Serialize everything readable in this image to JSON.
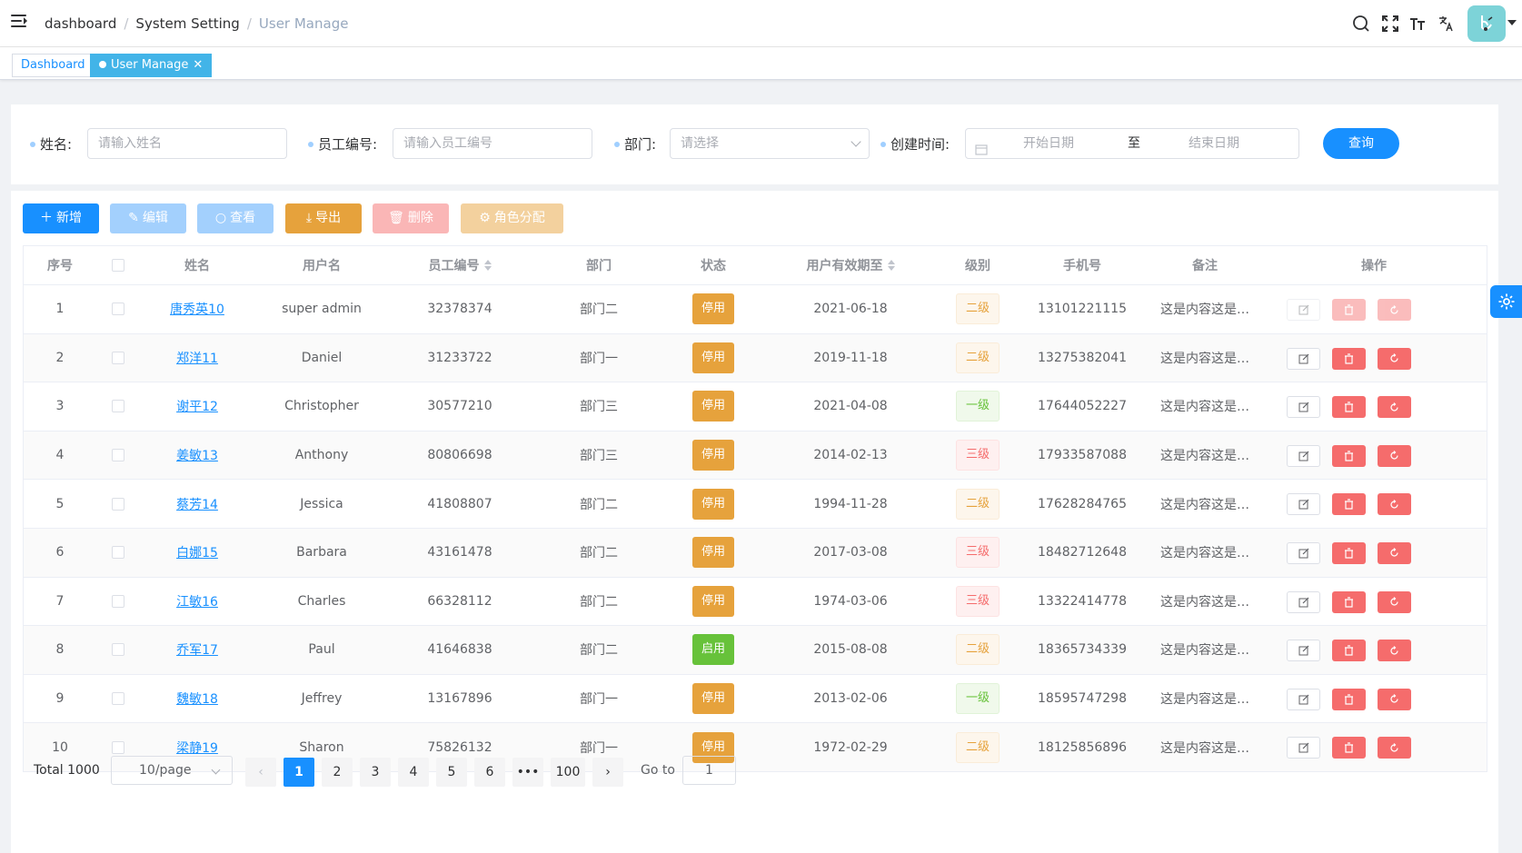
{
  "navbar": {
    "breadcrumbs": [
      "dashboard",
      "System Setting",
      "User Manage"
    ],
    "icons": [
      "search-icon",
      "fullscreen-icon",
      "font-size-icon",
      "translate-icon"
    ]
  },
  "tags": {
    "items": [
      {
        "label": "Dashboard",
        "active": false
      },
      {
        "label": "User Manage",
        "active": true,
        "close": "✕"
      }
    ]
  },
  "search": {
    "name_label": "姓名:",
    "name_placeholder": "请输入姓名",
    "empno_label": "员工编号:",
    "empno_placeholder": "请输入员工编号",
    "dept_label": "部门:",
    "dept_placeholder": "请选择",
    "created_label": "创建时间:",
    "start_placeholder": "开始日期",
    "range_sep": "至",
    "end_placeholder": "结束日期",
    "query_button": "查询"
  },
  "toolbar": {
    "add": "新增",
    "edit": "编辑",
    "view": "查看",
    "export": "导出",
    "delete": "删除",
    "role": "角色分配",
    "colors": {
      "add": "#1890ff",
      "edit": "#a3d0fd",
      "view": "#a3d0fd",
      "export": "#e6a23c",
      "delete": "#fab6b6",
      "role": "#f3d19e"
    }
  },
  "table": {
    "headers": [
      "序号",
      "",
      "姓名",
      "用户名",
      "员工编号",
      "部门",
      "状态",
      "用户有效期至",
      "级别",
      "手机号",
      "备注",
      "操作"
    ],
    "rows": [
      {
        "idx": "1",
        "name": "唐秀英10",
        "username": "super admin",
        "empno": "32378374",
        "dept": "部门二",
        "status": "停用",
        "expire": "2021-06-18",
        "level": "二级",
        "phone": "13101221115",
        "remark": "这是内容这是…",
        "ops_disabled": true
      },
      {
        "idx": "2",
        "name": "郑洋11",
        "username": "Daniel",
        "empno": "31233722",
        "dept": "部门一",
        "status": "停用",
        "expire": "2019-11-18",
        "level": "二级",
        "phone": "13275382041",
        "remark": "这是内容这是…",
        "ops_disabled": false
      },
      {
        "idx": "3",
        "name": "谢平12",
        "username": "Christopher",
        "empno": "30577210",
        "dept": "部门三",
        "status": "停用",
        "expire": "2021-04-08",
        "level": "一级",
        "phone": "17644052227",
        "remark": "这是内容这是…",
        "ops_disabled": false
      },
      {
        "idx": "4",
        "name": "姜敏13",
        "username": "Anthony",
        "empno": "80806698",
        "dept": "部门三",
        "status": "停用",
        "expire": "2014-02-13",
        "level": "三级",
        "phone": "17933587088",
        "remark": "这是内容这是…",
        "ops_disabled": false
      },
      {
        "idx": "5",
        "name": "蔡芳14",
        "username": "Jessica",
        "empno": "41808807",
        "dept": "部门二",
        "status": "停用",
        "expire": "1994-11-28",
        "level": "二级",
        "phone": "17628284765",
        "remark": "这是内容这是…",
        "ops_disabled": false
      },
      {
        "idx": "6",
        "name": "白娜15",
        "username": "Barbara",
        "empno": "43161478",
        "dept": "部门二",
        "status": "停用",
        "expire": "2017-03-08",
        "level": "三级",
        "phone": "18482712648",
        "remark": "这是内容这是…",
        "ops_disabled": false
      },
      {
        "idx": "7",
        "name": "江敏16",
        "username": "Charles",
        "empno": "66328112",
        "dept": "部门二",
        "status": "停用",
        "expire": "1974-03-06",
        "level": "三级",
        "phone": "13322414778",
        "remark": "这是内容这是…",
        "ops_disabled": false
      },
      {
        "idx": "8",
        "name": "乔军17",
        "username": "Paul",
        "empno": "41646838",
        "dept": "部门二",
        "status": "启用",
        "expire": "2015-08-08",
        "level": "二级",
        "phone": "18365734339",
        "remark": "这是内容这是…",
        "ops_disabled": false
      },
      {
        "idx": "9",
        "name": "魏敏18",
        "username": "Jeffrey",
        "empno": "13167896",
        "dept": "部门一",
        "status": "停用",
        "expire": "2013-02-06",
        "level": "一级",
        "phone": "18595747298",
        "remark": "这是内容这是…",
        "ops_disabled": false
      },
      {
        "idx": "10",
        "name": "梁静19",
        "username": "Sharon",
        "empno": "75826132",
        "dept": "部门一",
        "status": "停用",
        "expire": "1972-02-29",
        "level": "二级",
        "phone": "18125856896",
        "remark": "这是内容这是…",
        "ops_disabled": false
      }
    ],
    "status_colors": {
      "停用": "#e6a23c",
      "启用": "#67c23a"
    },
    "level_classes": {
      "一级": "l1",
      "二级": "l2",
      "三级": "l3"
    }
  },
  "pagination": {
    "total": "Total 1000",
    "page_size": "10/page",
    "pages": [
      "1",
      "2",
      "3",
      "4",
      "5",
      "6",
      "•••",
      "100"
    ],
    "current": "1",
    "prev": "‹",
    "next": "›",
    "goto_label": "Go to",
    "goto_value": "1"
  }
}
